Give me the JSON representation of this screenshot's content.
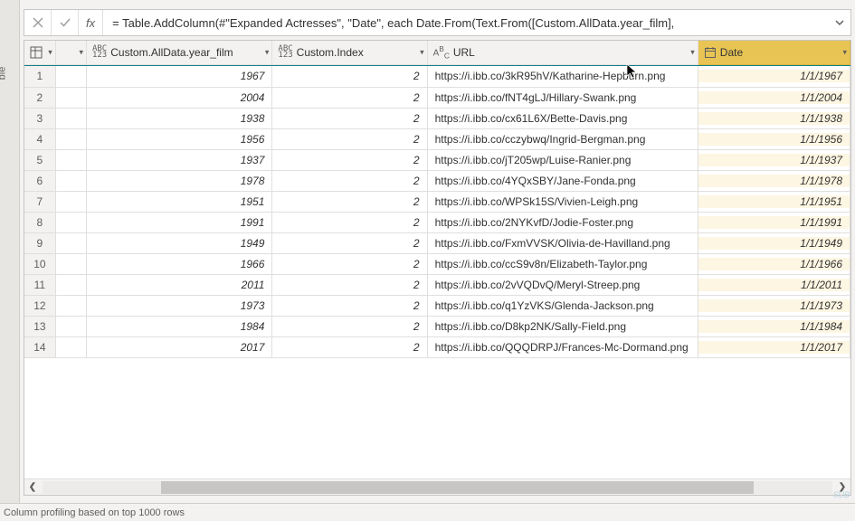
{
  "left_panel_label": "ble",
  "formula_bar": {
    "fx_label": "fx",
    "formula": "= Table.AddColumn(#\"Expanded Actresses\", \"Date\", each Date.From(Text.From([Custom.AllData.year_film],"
  },
  "columns": {
    "year": "Custom.AllData.year_film",
    "index": "Custom.Index",
    "url": "URL",
    "date": "Date"
  },
  "rows": [
    {
      "n": "1",
      "year": "1967",
      "index": "2",
      "url": "https://i.ibb.co/3kR95hV/Katharine-Hepburn.png",
      "date": "1/1/1967"
    },
    {
      "n": "2",
      "year": "2004",
      "index": "2",
      "url": "https://i.ibb.co/fNT4gLJ/Hillary-Swank.png",
      "date": "1/1/2004"
    },
    {
      "n": "3",
      "year": "1938",
      "index": "2",
      "url": "https://i.ibb.co/cx61L6X/Bette-Davis.png",
      "date": "1/1/1938"
    },
    {
      "n": "4",
      "year": "1956",
      "index": "2",
      "url": "https://i.ibb.co/cczybwq/Ingrid-Bergman.png",
      "date": "1/1/1956"
    },
    {
      "n": "5",
      "year": "1937",
      "index": "2",
      "url": "https://i.ibb.co/jT205wp/Luise-Ranier.png",
      "date": "1/1/1937"
    },
    {
      "n": "6",
      "year": "1978",
      "index": "2",
      "url": "https://i.ibb.co/4YQxSBY/Jane-Fonda.png",
      "date": "1/1/1978"
    },
    {
      "n": "7",
      "year": "1951",
      "index": "2",
      "url": "https://i.ibb.co/WPSk15S/Vivien-Leigh.png",
      "date": "1/1/1951"
    },
    {
      "n": "8",
      "year": "1991",
      "index": "2",
      "url": "https://i.ibb.co/2NYKvfD/Jodie-Foster.png",
      "date": "1/1/1991"
    },
    {
      "n": "9",
      "year": "1949",
      "index": "2",
      "url": "https://i.ibb.co/FxmVVSK/Olivia-de-Havilland.png",
      "date": "1/1/1949"
    },
    {
      "n": "10",
      "year": "1966",
      "index": "2",
      "url": "https://i.ibb.co/ccS9v8n/Elizabeth-Taylor.png",
      "date": "1/1/1966"
    },
    {
      "n": "11",
      "year": "2011",
      "index": "2",
      "url": "https://i.ibb.co/2vVQDvQ/Meryl-Streep.png",
      "date": "1/1/2011"
    },
    {
      "n": "12",
      "year": "1973",
      "index": "2",
      "url": "https://i.ibb.co/q1YzVKS/Glenda-Jackson.png",
      "date": "1/1/1973"
    },
    {
      "n": "13",
      "year": "1984",
      "index": "2",
      "url": "https://i.ibb.co/D8kp2NK/Sally-Field.png",
      "date": "1/1/1984"
    },
    {
      "n": "14",
      "year": "2017",
      "index": "2",
      "url": "https://i.ibb.co/QQQDRPJ/Frances-Mc-Dormand.png",
      "date": "1/1/2017"
    }
  ],
  "status": "Column profiling based on top 1000 rows"
}
